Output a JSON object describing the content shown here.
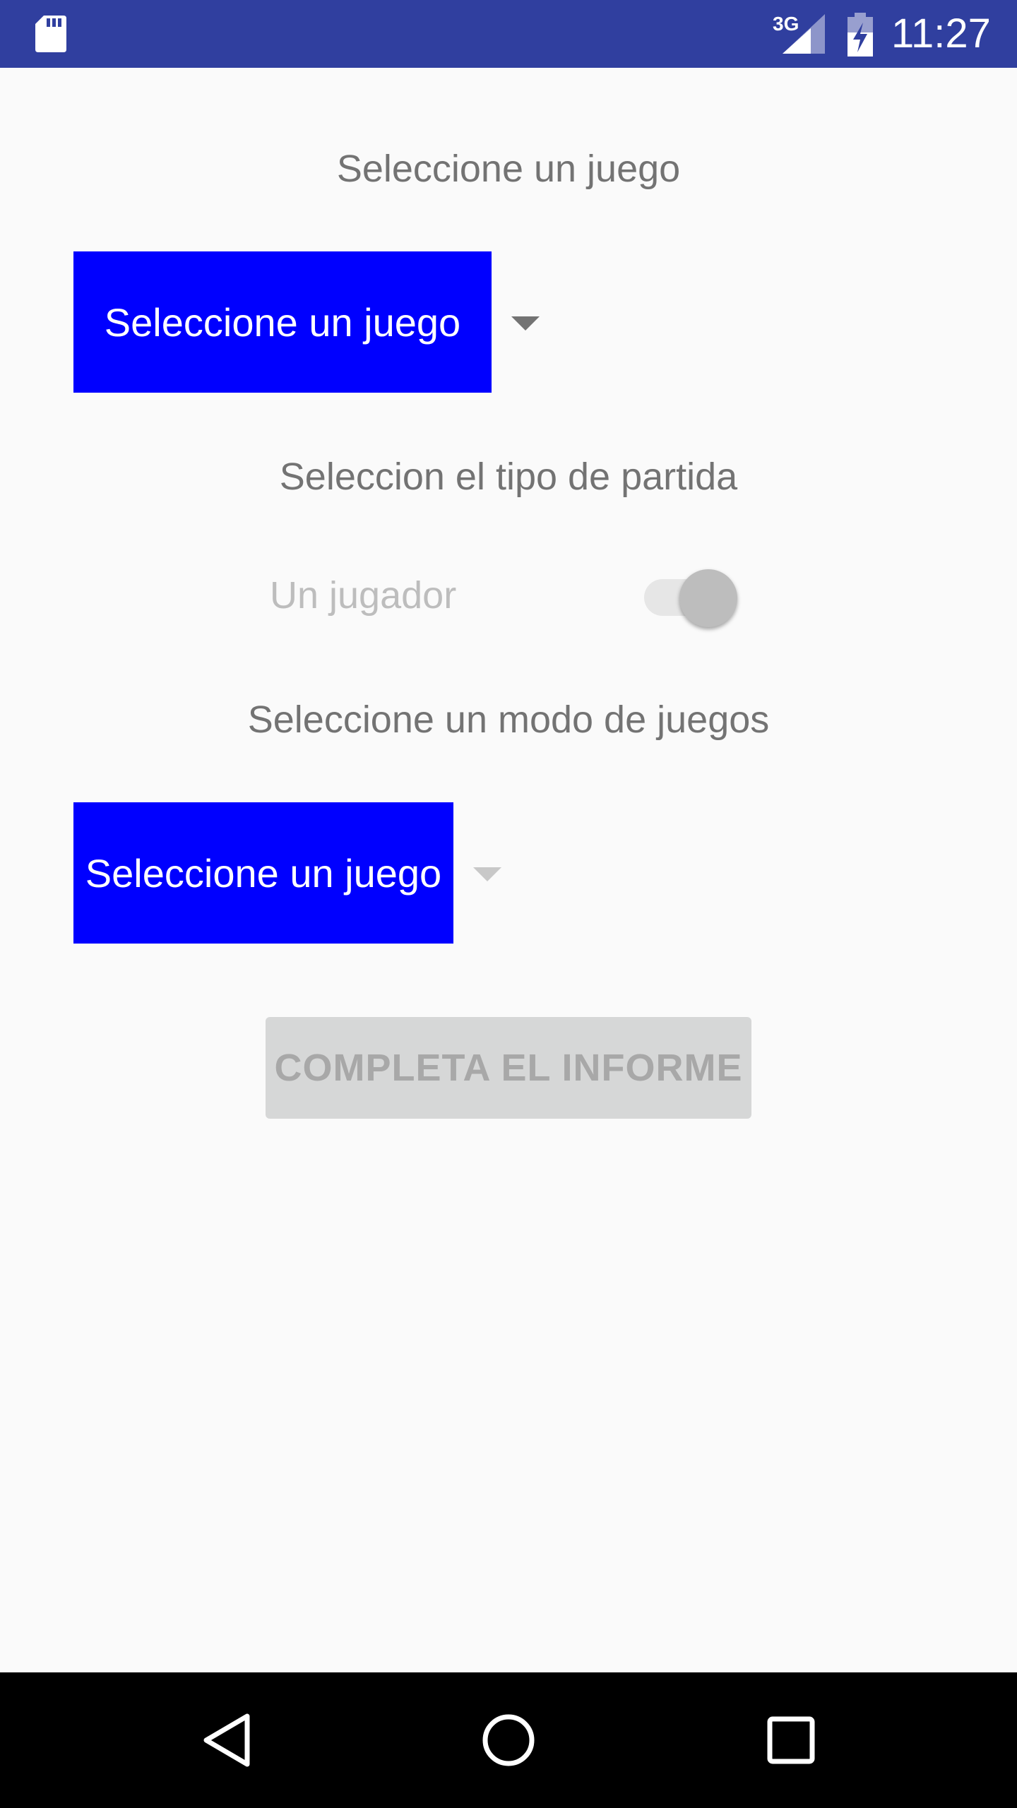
{
  "status_bar": {
    "network": "3G",
    "time": "11:27",
    "icons": [
      "sd-card-icon",
      "signal-icon",
      "battery-charging-icon"
    ]
  },
  "form": {
    "game_heading": "Seleccione un juego",
    "game_spinner_value": "Seleccione un juego",
    "match_type_heading": "Seleccion el tipo de partida",
    "switch_label": "Un jugador",
    "mode_heading": "Seleccione un modo de juegos",
    "mode_spinner_value": "Seleccione un juego",
    "submit_label": "COMPLETA EL INFORME"
  },
  "nav_bar": {
    "icons": [
      "back-icon",
      "home-icon",
      "recent-apps-icon"
    ]
  },
  "colors": {
    "status_bar": "#303f9f",
    "spinner_bg": "#0000ff",
    "background": "#fafafa",
    "disabled_button": "#d6d7d7",
    "nav_bar": "#000000"
  }
}
